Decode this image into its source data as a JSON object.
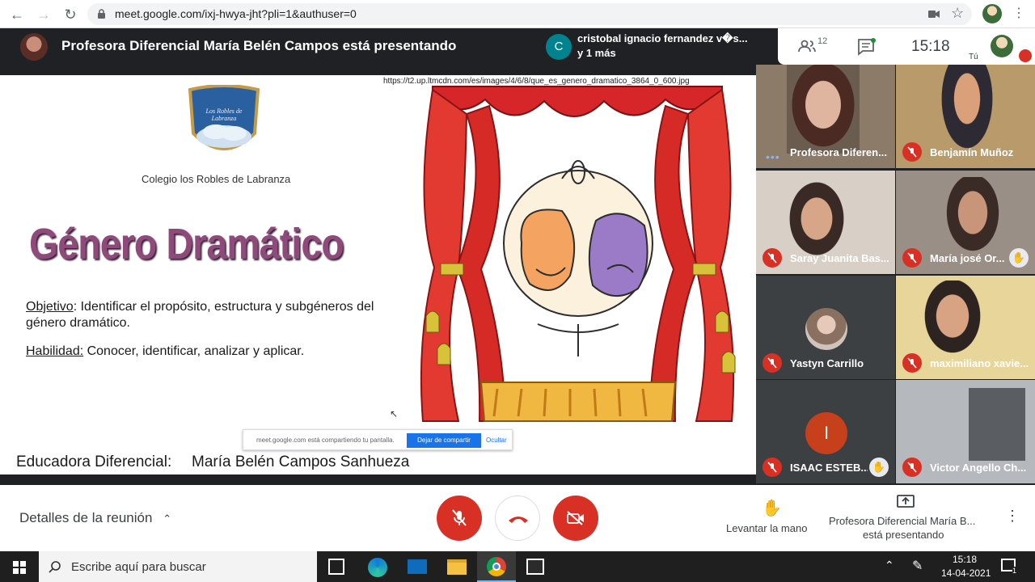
{
  "browser": {
    "url": "meet.google.com/ixj-hwya-jht?pli=1&authuser=0"
  },
  "banner": {
    "presenting_text": "Profesora Diferencial María Belén Campos está presentando"
  },
  "chat_preview": {
    "avatar_letter": "C",
    "line1": "cristobal ignacio fernandez v�s...",
    "line2": "y 1 más"
  },
  "toolbar": {
    "participants_count": "12",
    "time": "15:18",
    "self_label": "Tú"
  },
  "slide": {
    "image_url": "https://t2.up.ltmcdn.com/es/images/4/6/8/que_es_genero_dramatico_3864_0_600.jpg",
    "school_name": "Colegio los Robles de Labranza",
    "logo_text": "Los Robles de Labranza",
    "title": "Género Dramático",
    "objective_label": "Objetivo",
    "objective_text": ": Identificar el propósito, estructura y subgéneros del género dramático.",
    "skill_label": "Habilidad:",
    "skill_text": " Conocer, identificar, analizar y aplicar.",
    "educator_label": "Educadora Diferencial:",
    "educator_name": "María Belén Campos Sanhueza",
    "share_notice": "meet.google.com está compartiendo tu pantalla.",
    "stop_share": "Dejar de compartir",
    "hide": "Ocultar"
  },
  "participants": [
    {
      "name": "Profesora Diferen...",
      "muted": false
    },
    {
      "name": "Benjamín Muñoz",
      "muted": true
    },
    {
      "name": "Saray Juanita Bas...",
      "muted": true
    },
    {
      "name": "María josé Or...",
      "muted": true
    },
    {
      "name": "Yastyn Carrillo",
      "muted": true
    },
    {
      "name": "maximiliano xavie...",
      "muted": true
    },
    {
      "name": "ISAAC ESTEB...",
      "muted": true,
      "initial": "I"
    },
    {
      "name": "Victor Angello Ch...",
      "muted": true
    }
  ],
  "bottom": {
    "meeting_details": "Detalles de la reunión",
    "raise_hand": "Levantar la mano",
    "presenting_line1": "Profesora Diferencial María B...",
    "presenting_line2": "está presentando"
  },
  "taskbar": {
    "search_placeholder": "Escribe aquí para buscar",
    "time": "15:18",
    "date": "14-04-2021",
    "notifications": "1"
  },
  "colors": {
    "meet_red": "#d93025",
    "meet_dark": "#202124",
    "share_blue": "#1a73e8"
  }
}
